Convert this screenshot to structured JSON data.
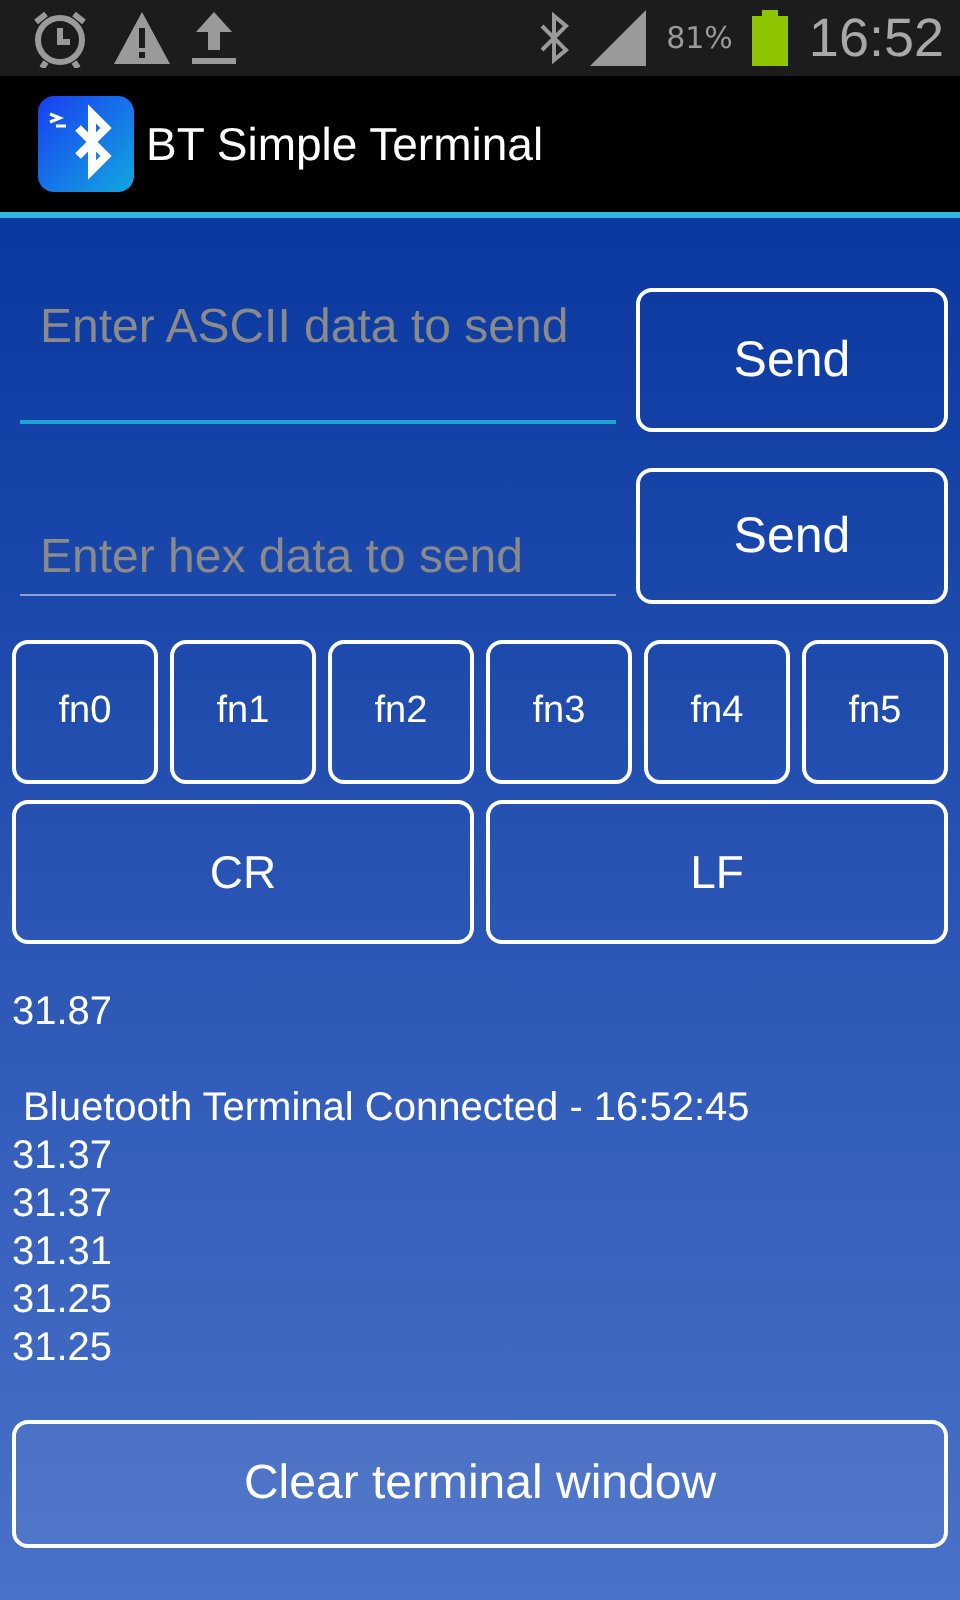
{
  "status_bar": {
    "battery_text": "81%",
    "time": "16:52"
  },
  "app_bar": {
    "title": "BT Simple Terminal"
  },
  "inputs": [
    {
      "placeholder": "Enter ASCII data to send",
      "focused": true,
      "button": "Send"
    },
    {
      "placeholder": "Enter hex data to send",
      "focused": false,
      "button": "Send"
    }
  ],
  "function_keys": [
    "fn0",
    "fn1",
    "fn2",
    "fn3",
    "fn4",
    "fn5"
  ],
  "line_keys": [
    "CR",
    "LF"
  ],
  "terminal": [
    {
      "text": "31.87",
      "gap_before": false
    },
    {
      "text": " Bluetooth Terminal Connected - 16:52:45",
      "gap_before": true
    },
    {
      "text": "31.37",
      "gap_before": false
    },
    {
      "text": "31.37",
      "gap_before": false
    },
    {
      "text": "31.31",
      "gap_before": false
    },
    {
      "text": "31.25",
      "gap_before": false
    },
    {
      "text": "31.25",
      "gap_before": false
    }
  ],
  "clear_button": "Clear terminal window"
}
